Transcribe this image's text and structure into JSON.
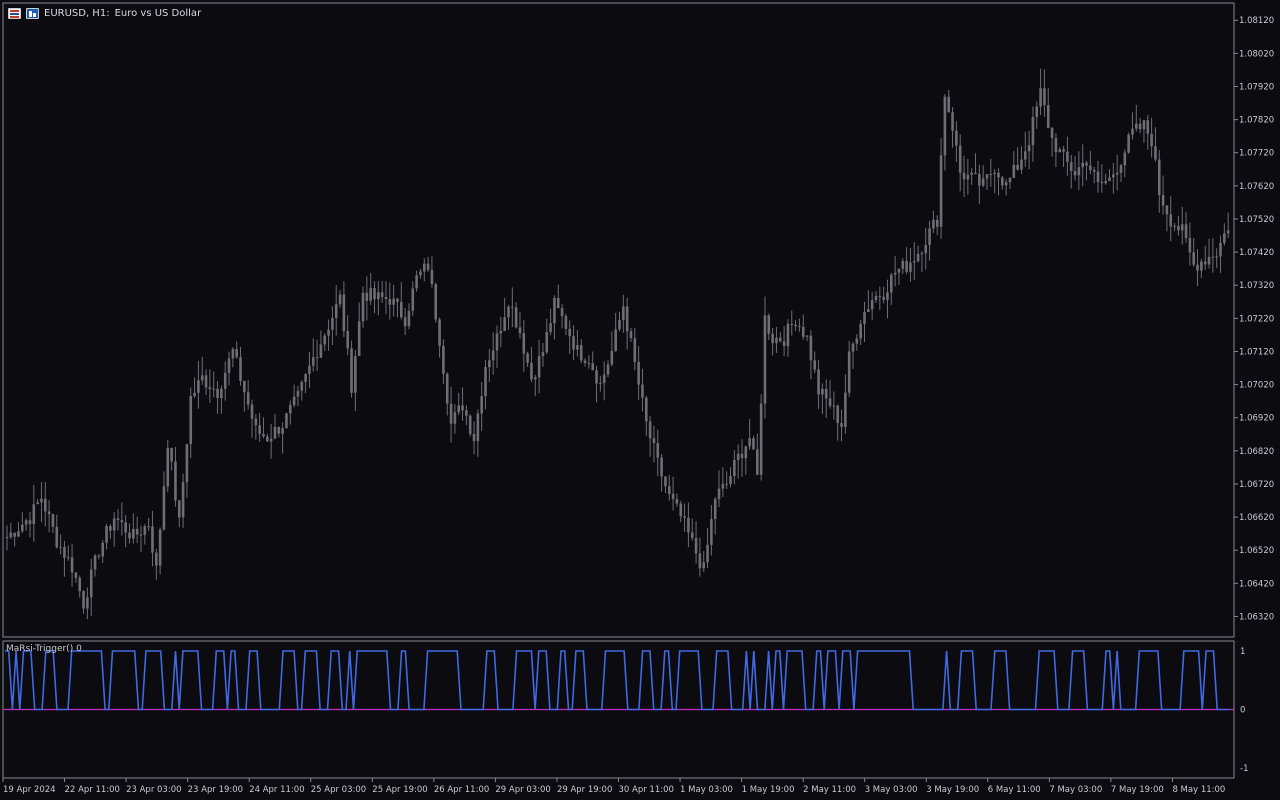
{
  "header": {
    "symbol": "EURUSD, H1:",
    "description": "Euro vs US Dollar",
    "icons": [
      "price-chart-icon",
      "one-click-trading-icon"
    ]
  },
  "indicator": {
    "label": "MaRsi-Trigger() 0",
    "levels": [
      "1",
      "0",
      "-1"
    ]
  },
  "colors": {
    "background": "#0b0b10",
    "candle": "#6e6e73",
    "axis_text": "#c9c9d0",
    "trigger_line": "#4169e1",
    "zero_line": "#c030c0"
  },
  "chart_data": [
    {
      "type": "candlestick",
      "title": "EURUSD, H1: Euro vs US Dollar",
      "y_ticks": [
        "1.08120",
        "1.08020",
        "1.07920",
        "1.07820",
        "1.07720",
        "1.07620",
        "1.07520",
        "1.07420",
        "1.07320",
        "1.07220",
        "1.07120",
        "1.07020",
        "1.06920",
        "1.06820",
        "1.06720",
        "1.06620",
        "1.06520",
        "1.06420",
        "1.06320"
      ],
      "ylim": [
        1.0627,
        1.0816
      ],
      "x_ticks": [
        "19 Apr 2024",
        "22 Apr 11:00",
        "23 Apr 03:00",
        "23 Apr 19:00",
        "24 Apr 11:00",
        "25 Apr 03:00",
        "25 Apr 19:00",
        "26 Apr 11:00",
        "29 Apr 03:00",
        "29 Apr 19:00",
        "30 Apr 11:00",
        "1 May 03:00",
        "1 May 19:00",
        "2 May 11:00",
        "3 May 03:00",
        "3 May 19:00",
        "6 May 11:00",
        "7 May 03:00",
        "7 May 19:00",
        "8 May 11:00"
      ],
      "anchors": [
        [
          0,
          1.0656
        ],
        [
          6,
          1.0662
        ],
        [
          9,
          1.0668
        ],
        [
          13,
          1.0655
        ],
        [
          17,
          1.0647
        ],
        [
          20,
          1.0636
        ],
        [
          24,
          1.0652
        ],
        [
          28,
          1.0662
        ],
        [
          33,
          1.0656
        ],
        [
          37,
          1.066
        ],
        [
          39,
          1.0646
        ],
        [
          42,
          1.0685
        ],
        [
          45,
          1.066
        ],
        [
          48,
          1.0698
        ],
        [
          51,
          1.0704
        ],
        [
          55,
          1.07
        ],
        [
          59,
          1.0712
        ],
        [
          62,
          1.07
        ],
        [
          65,
          1.0688
        ],
        [
          68,
          1.0686
        ],
        [
          72,
          1.069
        ],
        [
          76,
          1.0698
        ],
        [
          80,
          1.071
        ],
        [
          84,
          1.072
        ],
        [
          87,
          1.0728
        ],
        [
          90,
          1.0702
        ],
        [
          93,
          1.073
        ],
        [
          96,
          1.0728
        ],
        [
          100,
          1.0728
        ],
        [
          104,
          1.0722
        ],
        [
          107,
          1.0734
        ],
        [
          110,
          1.0738
        ],
        [
          113,
          1.0716
        ],
        [
          116,
          1.069
        ],
        [
          119,
          1.0696
        ],
        [
          122,
          1.0686
        ],
        [
          125,
          1.0708
        ],
        [
          128,
          1.0716
        ],
        [
          131,
          1.0728
        ],
        [
          134,
          1.0718
        ],
        [
          137,
          1.0704
        ],
        [
          140,
          1.0712
        ],
        [
          143,
          1.0726
        ],
        [
          146,
          1.072
        ],
        [
          149,
          1.0712
        ],
        [
          152,
          1.071
        ],
        [
          155,
          1.0702
        ],
        [
          158,
          1.0712
        ],
        [
          161,
          1.0726
        ],
        [
          164,
          1.0708
        ],
        [
          167,
          1.069
        ],
        [
          170,
          1.0678
        ],
        [
          173,
          1.0668
        ],
        [
          176,
          1.0662
        ],
        [
          179,
          1.0654
        ],
        [
          182,
          1.0646
        ],
        [
          185,
          1.0668
        ],
        [
          188,
          1.0672
        ],
        [
          191,
          1.068
        ],
        [
          194,
          1.0686
        ],
        [
          196,
          1.0674
        ],
        [
          198,
          1.0722
        ],
        [
          200,
          1.0716
        ],
        [
          203,
          1.0716
        ],
        [
          206,
          1.0722
        ],
        [
          209,
          1.0716
        ],
        [
          212,
          1.07
        ],
        [
          215,
          1.0696
        ],
        [
          218,
          1.069
        ],
        [
          220,
          1.071
        ],
        [
          223,
          1.0722
        ],
        [
          226,
          1.0728
        ],
        [
          229,
          1.073
        ],
        [
          232,
          1.0736
        ],
        [
          235,
          1.0738
        ],
        [
          238,
          1.0742
        ],
        [
          241,
          1.0748
        ],
        [
          243,
          1.0752
        ],
        [
          245,
          1.079
        ],
        [
          247,
          1.078
        ],
        [
          249,
          1.0766
        ],
        [
          252,
          1.0764
        ],
        [
          255,
          1.0762
        ],
        [
          258,
          1.0768
        ],
        [
          261,
          1.0762
        ],
        [
          264,
          1.0768
        ],
        [
          267,
          1.0776
        ],
        [
          270,
          1.079
        ],
        [
          273,
          1.0776
        ],
        [
          276,
          1.077
        ],
        [
          279,
          1.0766
        ],
        [
          282,
          1.077
        ],
        [
          285,
          1.0762
        ],
        [
          288,
          1.0764
        ],
        [
          291,
          1.077
        ],
        [
          294,
          1.0778
        ],
        [
          297,
          1.078
        ],
        [
          299,
          1.0776
        ],
        [
          301,
          1.076
        ],
        [
          304,
          1.0752
        ],
        [
          307,
          1.0748
        ],
        [
          310,
          1.0738
        ],
        [
          313,
          1.074
        ],
        [
          316,
          1.0742
        ],
        [
          319,
          1.075
        ]
      ],
      "candle_count": 320
    },
    {
      "type": "line",
      "title": "MaRsi-Trigger() 0",
      "ylim": [
        -1,
        1
      ],
      "states": "1101011100011100001111111110011111110011111000101111100001110110001110000001111001111000111001011111111100011000001111111110000000111000001111101110001100111000001111110000111000110011111100001111000010100010110111110001101110111011111111111111100000000010001111000001111000000001111100001111000001101000001111110000001111101110000",
      "series": [
        {
          "name": "",
          "values": "see states: 1 = +1, 0 = 0, 2 = -1"
        }
      ]
    }
  ]
}
